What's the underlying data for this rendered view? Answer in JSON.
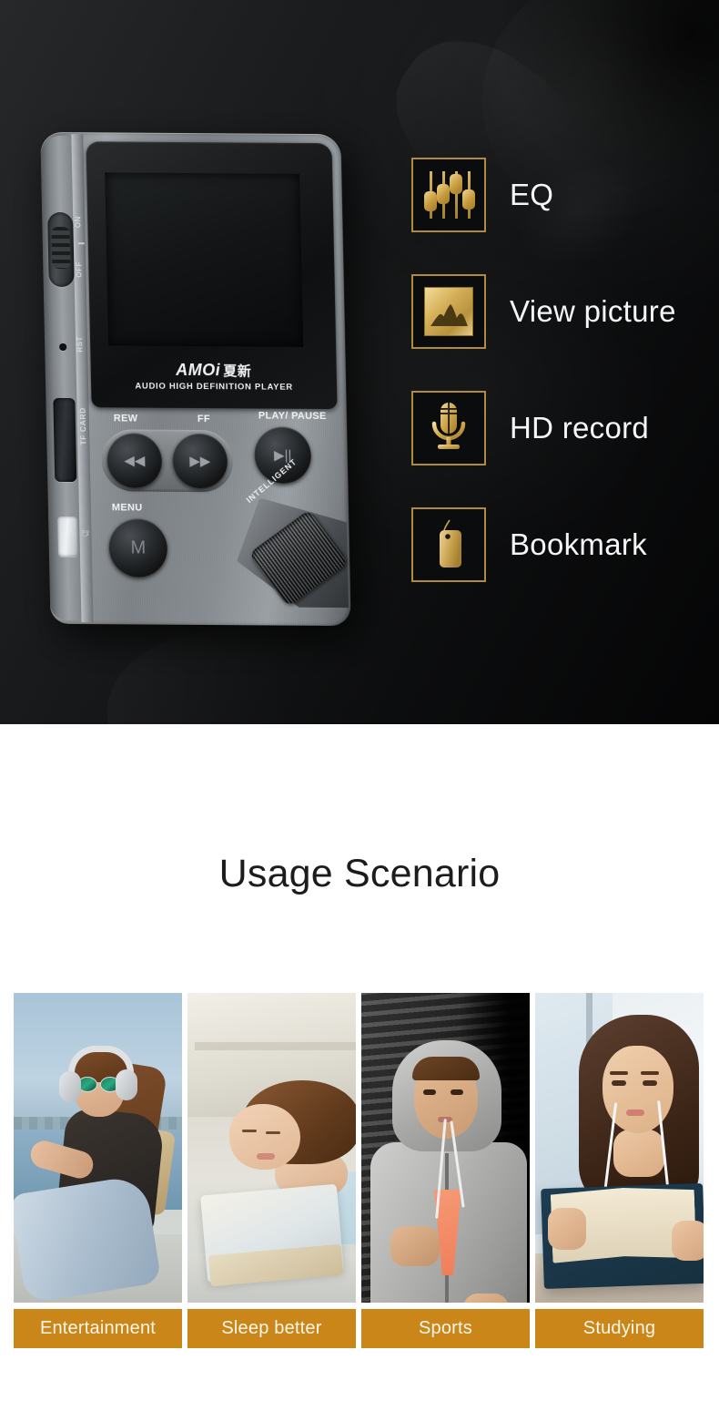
{
  "hero": {
    "device": {
      "brand": "AMOi",
      "brand_cn": "夏新",
      "subtitle": "AUDIO HIGH DEFINITION PLAYER",
      "switch_on_label": "ON",
      "switch_off_label": "OFF",
      "reset_label": "RST",
      "tf_card_label": "TF CARD",
      "usb_label": "USB",
      "buttons": {
        "rew": "REW",
        "ff": "FF",
        "play_pause": "PLAY/ PAUSE",
        "menu": "MENU",
        "menu_glyph": "M",
        "rew_glyph": "◀◀",
        "ff_glyph": "▶▶",
        "play_glyph": "▶||"
      },
      "wheel_label": "INTELLIGENT"
    },
    "features": [
      {
        "label": "EQ",
        "icon": "equalizer-icon"
      },
      {
        "label": "View picture",
        "icon": "picture-icon"
      },
      {
        "label": "HD record",
        "icon": "microphone-icon"
      },
      {
        "label": "Bookmark",
        "icon": "bookmark-tag-icon"
      }
    ],
    "colors": {
      "background": "#0e1011",
      "gold_frame": "#b08b3e",
      "gold_fill": "#d4ae57",
      "label_text": "#f4f6f8"
    }
  },
  "usage": {
    "title": "Usage Scenario",
    "caption_color": "#ca8618",
    "scenarios": [
      {
        "caption": "Entertainment",
        "scene": "woman-with-headphones-by-water"
      },
      {
        "caption": "Sleep better",
        "scene": "woman-asleep-on-book"
      },
      {
        "caption": "Sports",
        "scene": "woman-jogging-in-hoodie-with-earphones"
      },
      {
        "caption": "Studying",
        "scene": "woman-reading-book-with-earphones"
      }
    ]
  }
}
